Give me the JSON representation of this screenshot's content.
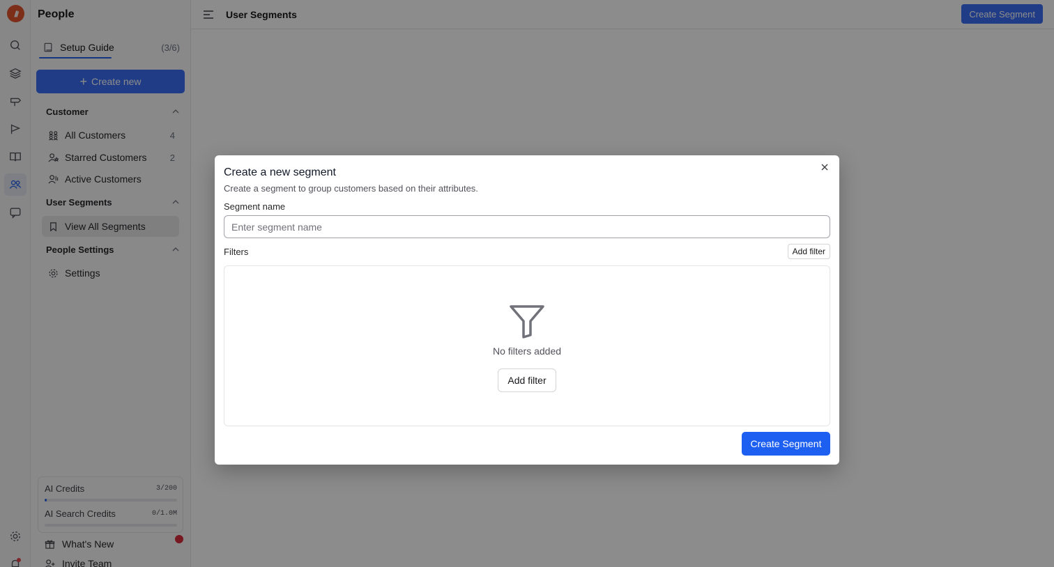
{
  "app": {
    "title": "People"
  },
  "setup_guide": {
    "label": "Setup Guide",
    "progress": "(3/6)"
  },
  "create_new": {
    "label": "Create new"
  },
  "sections": {
    "customer": {
      "title": "Customer",
      "items": [
        {
          "label": "All Customers",
          "count": "4"
        },
        {
          "label": "Starred Customers",
          "count": "2"
        },
        {
          "label": "Active Customers",
          "count": ""
        }
      ]
    },
    "user_segments": {
      "title": "User Segments",
      "items": [
        {
          "label": "View All Segments"
        }
      ]
    },
    "people_settings": {
      "title": "People Settings",
      "items": [
        {
          "label": "Settings"
        }
      ]
    }
  },
  "credits": {
    "ai": {
      "label": "AI Credits",
      "value": "3/200",
      "fraction": 0.015
    },
    "ai_search": {
      "label": "AI Search Credits",
      "value": "0/1.0M",
      "fraction": 0
    }
  },
  "footer": {
    "whats_new": "What's New",
    "invite_team": "Invite Team"
  },
  "header": {
    "title": "User Segments",
    "create_button": "Create Segment"
  },
  "modal": {
    "title": "Create a new segment",
    "subtitle": "Create a segment to group customers based on their attributes.",
    "name_label": "Segment name",
    "name_placeholder": "Enter segment name",
    "filters_label": "Filters",
    "add_filter": "Add filter",
    "empty_text": "No filters added",
    "add_filter_large": "Add filter",
    "create_button": "Create Segment"
  },
  "colors": {
    "accent": "#3b6ef5",
    "logo": "#e2552c",
    "notification": "#d92d3b"
  }
}
